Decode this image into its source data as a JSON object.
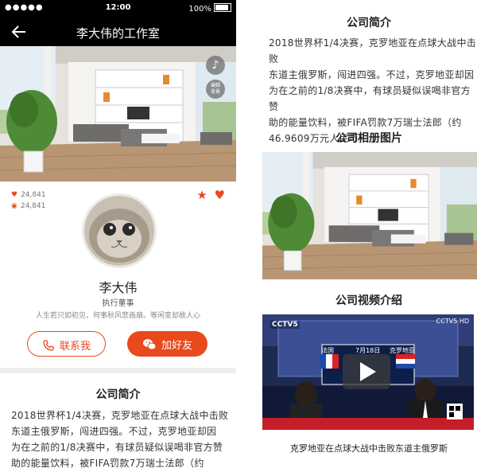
{
  "status_bar": {
    "time": "12:00",
    "signal": "●●●●●",
    "battery": "100%"
  },
  "header": {
    "title": "李大伟的工作室"
  },
  "banner": {
    "music_icon": "music-note-icon",
    "edit_label_1": "编辑",
    "edit_label_2": "背景"
  },
  "stats": {
    "likes": "24,841",
    "views": "24,841"
  },
  "profile": {
    "name": "李大伟",
    "role": "执行董事",
    "motto": "人生若只如初见，何事秋风悲画扇。等闲变却故人心"
  },
  "buttons": {
    "contact": "联系我",
    "add_friend": "加好友"
  },
  "sections": {
    "company_intro": "公司简介",
    "company_album": "公司相册图片",
    "company_video": "公司视频介绍"
  },
  "intro_text": {
    "line1": "2018世界杯1/4决赛，克罗地亚在点球大战中击败",
    "line2": "东道主俄罗斯，闯进四强。不过，克罗地亚却因",
    "line3": "为在之前的1/8决赛中，有球员疑似误喝非官方赞",
    "line4": "助的能量饮料，被FIFA罚款7万瑞士法郎（约",
    "line5": "46.9609万元人民币）"
  },
  "video": {
    "caption": "克罗地亚在点球大战中击败东道主俄罗斯",
    "channel": "CCTV5",
    "team_left": "法国",
    "team_right": "克罗地亚",
    "date": "7月18日",
    "watermark": "CCTV5 HD"
  },
  "colors": {
    "accent": "#e8491d",
    "header_bg": "#000000"
  }
}
